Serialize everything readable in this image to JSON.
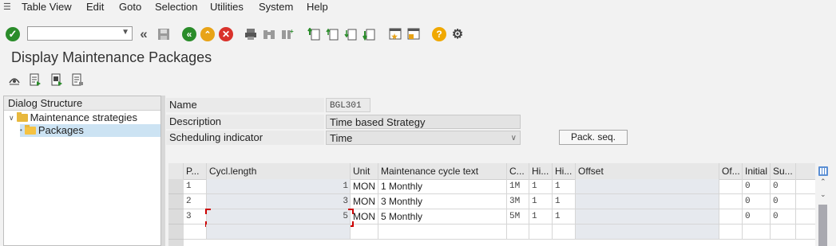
{
  "menu": [
    "Table View",
    "Edit",
    "Goto",
    "Selection",
    "Utilities",
    "System",
    "Help"
  ],
  "page_title": "Display Maintenance Packages",
  "dialog_structure": {
    "header": "Dialog Structure",
    "items": [
      {
        "label": "Maintenance strategies",
        "level": 0
      },
      {
        "label": "Packages",
        "level": 1,
        "selected": true
      }
    ]
  },
  "form": {
    "name_label": "Name",
    "name_value": "BGL301",
    "description_label": "Description",
    "description_value": "Time based Strategy",
    "scheduling_label": "Scheduling indicator",
    "scheduling_value": "Time",
    "pack_seq_button": "Pack. seq."
  },
  "table": {
    "columns": [
      "P...",
      "Cycl.length",
      "Unit",
      "Maintenance cycle text",
      "C...",
      "Hi...",
      "Hi...",
      "Offset",
      "Of...",
      "Initial",
      "Su..."
    ],
    "rows": [
      {
        "p": "1",
        "cycl": "1",
        "unit": "MON",
        "text": "1 Monthly",
        "c": "1M",
        "hi1": "1",
        "hi2": "1",
        "offset": "",
        "of": "",
        "initial": "0",
        "su": "0"
      },
      {
        "p": "2",
        "cycl": "3",
        "unit": "MON",
        "text": "3 Monthly",
        "c": "3M",
        "hi1": "1",
        "hi2": "1",
        "offset": "",
        "of": "",
        "initial": "0",
        "su": "0"
      },
      {
        "p": "3",
        "cycl": "5",
        "unit": "MON",
        "text": "5 Monthly",
        "c": "5M",
        "hi1": "1",
        "hi2": "1",
        "offset": "",
        "of": "",
        "initial": "0",
        "su": "0"
      }
    ]
  },
  "colors": {
    "green": "#2a8c2a",
    "orange": "#e8a317",
    "red": "#d9322b",
    "folder": "#e8b83d",
    "help": "#f0a800"
  }
}
